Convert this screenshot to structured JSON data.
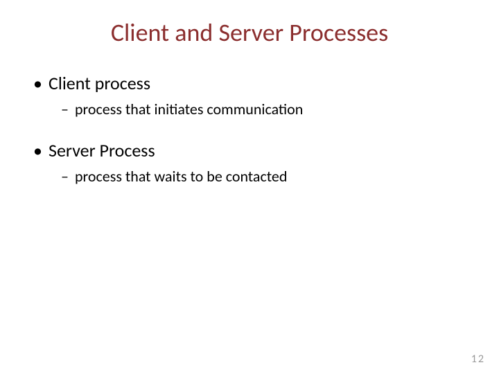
{
  "slide": {
    "title": "Client and Server Processes",
    "bullets": [
      {
        "label": "Client process",
        "sub": "process that initiates communication"
      },
      {
        "label": "Server Process",
        "sub": "process that waits to be contacted"
      }
    ],
    "pageNumber": "12"
  }
}
